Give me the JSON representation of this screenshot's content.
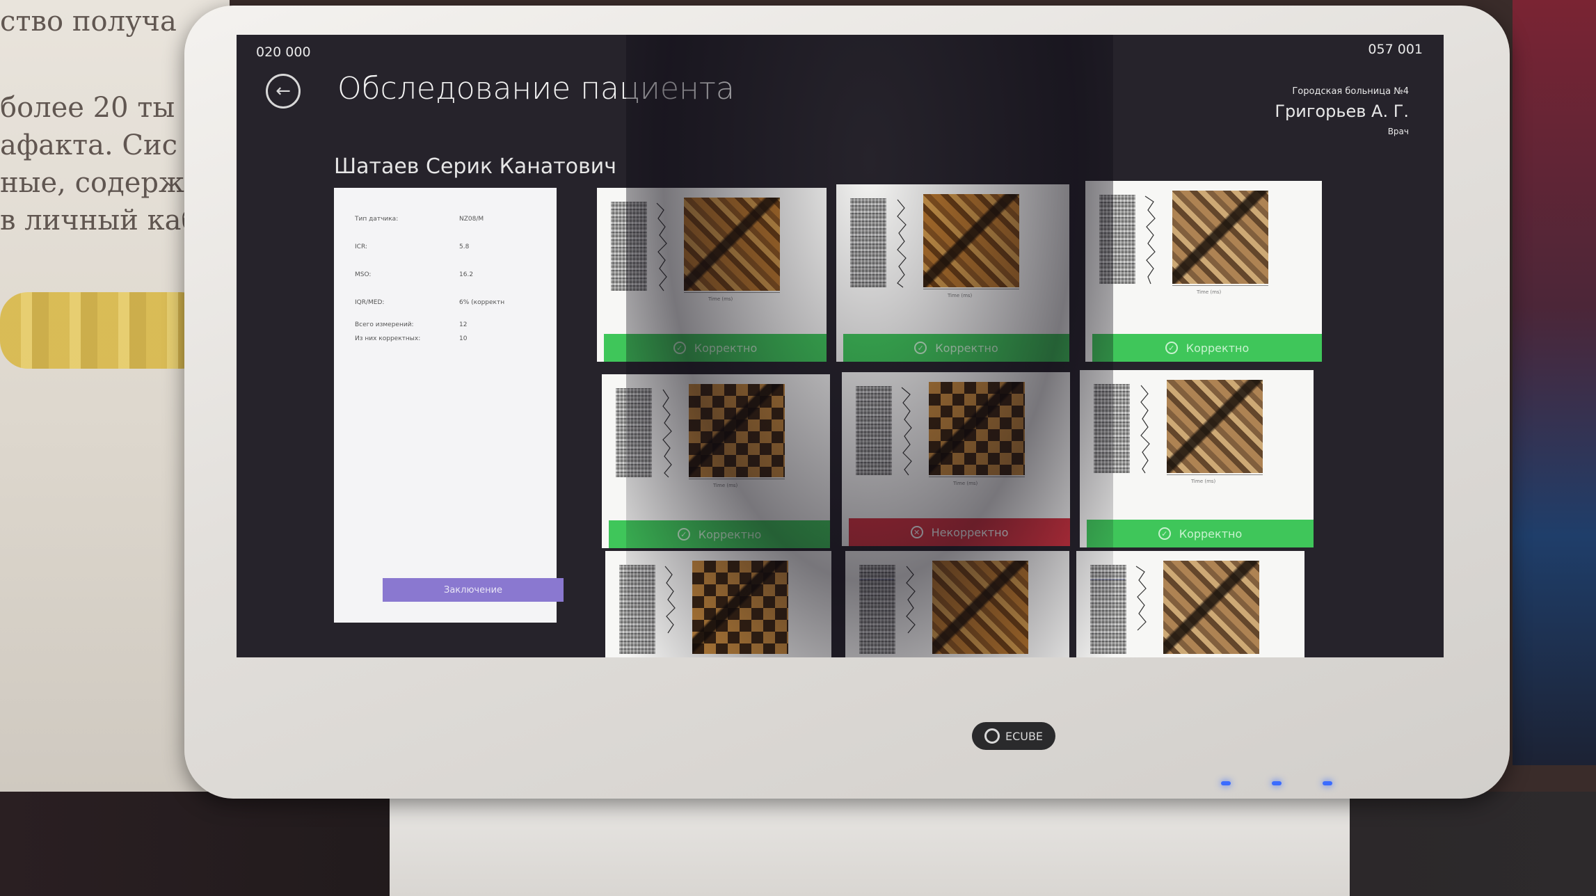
{
  "photo": {
    "book_lines": [
      "ство получа",
      "более 20 ты",
      "афакта. Сис",
      "ные, содержа",
      "в личный каб"
    ]
  },
  "screen": {
    "hint_left": "020   000",
    "hint_right": "057   001",
    "back_icon": "arrow-left-icon",
    "title": "Обследование пациента",
    "org": "Городская больница №4",
    "doctor": "Григорьев А. Г.",
    "role": "Врач",
    "patient_name": "Шатаев Серик Канатович",
    "info_rows": [
      {
        "label": "Тип датчика:",
        "value": "NZ08/M"
      },
      {
        "label": "ICR:",
        "value": "5.8"
      },
      {
        "label": "MSO:",
        "value": "16.2"
      },
      {
        "label": "IQR/MED:",
        "value": "6% (корректн"
      },
      {
        "label": "Всего измерений:",
        "value": "12"
      },
      {
        "label": "Из них корректных:",
        "value": "10"
      }
    ],
    "info_button": "Заключение",
    "thumbnails": [
      {
        "status": "ok",
        "label": "Корректно",
        "icon": "check-circle-icon"
      },
      {
        "status": "ok",
        "label": "Корректно",
        "icon": "check-circle-icon"
      },
      {
        "status": "ok",
        "label": "Корректно",
        "icon": "check-circle-icon"
      },
      {
        "status": "ok",
        "label": "Корректно",
        "icon": "check-circle-icon"
      },
      {
        "status": "bad",
        "label": "Некорректно",
        "icon": "x-circle-icon"
      },
      {
        "status": "ok",
        "label": "Корректно",
        "icon": "check-circle-icon"
      },
      {
        "status": "none",
        "label": "",
        "icon": ""
      },
      {
        "status": "none",
        "label": "",
        "icon": ""
      },
      {
        "status": "none",
        "label": "",
        "icon": ""
      }
    ],
    "axis_label": "Time (ms)"
  },
  "monitor": {
    "brand": "ECUBE"
  },
  "colors": {
    "ok": "#3fc65a",
    "bad": "#d63340",
    "accent_button": "#8a78d0",
    "screen_bg": "#26232b"
  }
}
